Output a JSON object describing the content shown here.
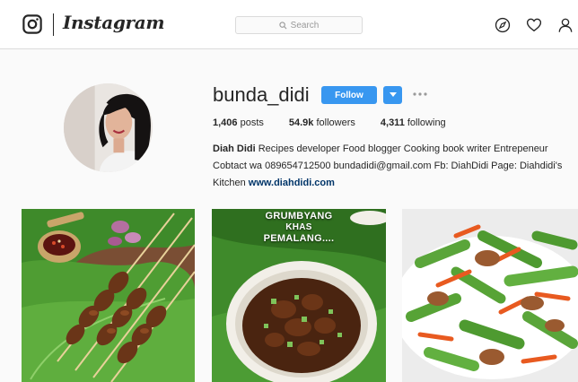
{
  "header": {
    "wordmark": "Instagram",
    "search_placeholder": "Search"
  },
  "profile": {
    "username": "bunda_didi",
    "follow_label": "Follow",
    "stats": {
      "posts_count": "1,406",
      "posts_label": "posts",
      "followers_count": "54.9k",
      "followers_label": "followers",
      "following_count": "4,311",
      "following_label": "following"
    },
    "bio": {
      "full_name": "Diah Didi",
      "line_part1": "Recipes developer Food blogger Cooking book writer Entrepeneur Cobtact wa 089654712500 bundadidi@gmail.com Fb: DiahDidi Page: Diahdidi's Kitchen",
      "website": "www.diahdidi.com"
    }
  },
  "posts": [
    {
      "caption_line1": "",
      "caption_line2": ""
    },
    {
      "caption_line1": "GRUMBYANG",
      "caption_line2": "KHAS",
      "caption_line3": "PEMALANG...."
    },
    {
      "caption_line1": "",
      "caption_line2": ""
    }
  ],
  "icons": {
    "logo": "instagram-camera-icon",
    "search": "search-icon",
    "explore": "compass-icon",
    "activity": "heart-icon",
    "profile": "user-icon",
    "dropdown": "caret-down-icon",
    "more": "more-dots-icon"
  },
  "colors": {
    "follow_button": "#3897f0",
    "link": "#003569",
    "background": "#fafafa"
  }
}
